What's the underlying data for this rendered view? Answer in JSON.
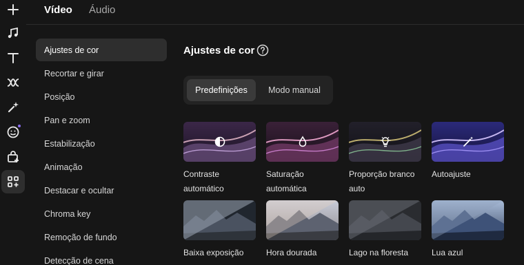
{
  "rail": {
    "items": [
      {
        "icon": "plus-icon"
      },
      {
        "icon": "music-note-icon"
      },
      {
        "icon": "text-icon"
      },
      {
        "icon": "transition-icon"
      },
      {
        "icon": "effects-sparkle-icon"
      },
      {
        "icon": "sticker-emoji-icon"
      },
      {
        "icon": "shopping-bag-icon"
      },
      {
        "icon": "apps-grid-icon"
      }
    ]
  },
  "top_tabs": {
    "video": "Vídeo",
    "audio": "Áudio"
  },
  "sidebar": {
    "items": [
      {
        "label": "Ajustes de cor"
      },
      {
        "label": "Recortar e girar"
      },
      {
        "label": "Posição"
      },
      {
        "label": "Pan e zoom"
      },
      {
        "label": "Estabilização"
      },
      {
        "label": "Animação"
      },
      {
        "label": "Destacar e ocultar"
      },
      {
        "label": "Chroma key"
      },
      {
        "label": "Remoção de fundo"
      },
      {
        "label": "Detecção de cena"
      }
    ]
  },
  "main": {
    "title": "Ajustes de cor",
    "segmented": {
      "presets": "Predefinições",
      "manual": "Modo manual"
    },
    "cards": [
      {
        "label": "Contraste automático",
        "icon": "contrast-icon"
      },
      {
        "label": "Saturação automática",
        "icon": "droplet-icon"
      },
      {
        "label": "Proporção branco auto",
        "icon": "bulb-icon"
      },
      {
        "label": "Autoajuste",
        "icon": "magic-wand-icon"
      },
      {
        "label": "Baixa exposição",
        "icon": "mountain-preview"
      },
      {
        "label": "Hora dourada",
        "icon": "mountain-preview"
      },
      {
        "label": "Lago na floresta",
        "icon": "mountain-preview"
      },
      {
        "label": "Lua azul",
        "icon": "mountain-preview"
      }
    ]
  },
  "colors": {
    "accent_dot": "#8a6cf0",
    "active_bg": "#2e2e2e",
    "background": "#161616"
  }
}
